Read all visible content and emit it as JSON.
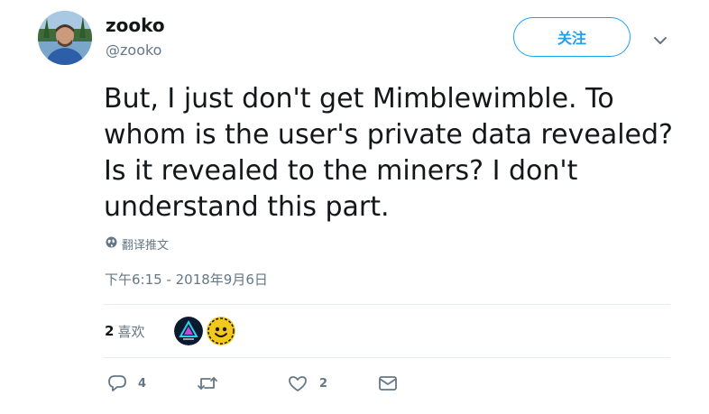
{
  "user": {
    "display_name": "zooko",
    "handle": "@zooko"
  },
  "follow_label": "关注",
  "tweet": {
    "text_lines": [
      "But, I just don't get Mimblewimble. To",
      "whom is the user's private data revealed?",
      "Is it revealed to the miners? I don't",
      "understand this part."
    ]
  },
  "translate_label": "翻译推文",
  "timestamp": "下午6:15 - 2018年9月6日",
  "likes": {
    "count": "2",
    "label": "喜欢"
  },
  "actions": {
    "reply_count": "4",
    "retweet_count": "",
    "like_count": "2"
  },
  "colors": {
    "accent": "#1da1f2",
    "secondary_text": "#657786",
    "divider": "#e6ecf0"
  },
  "icons": [
    "globe-icon",
    "chevron-down-icon",
    "reply-icon",
    "retweet-icon",
    "heart-icon",
    "mail-icon"
  ]
}
